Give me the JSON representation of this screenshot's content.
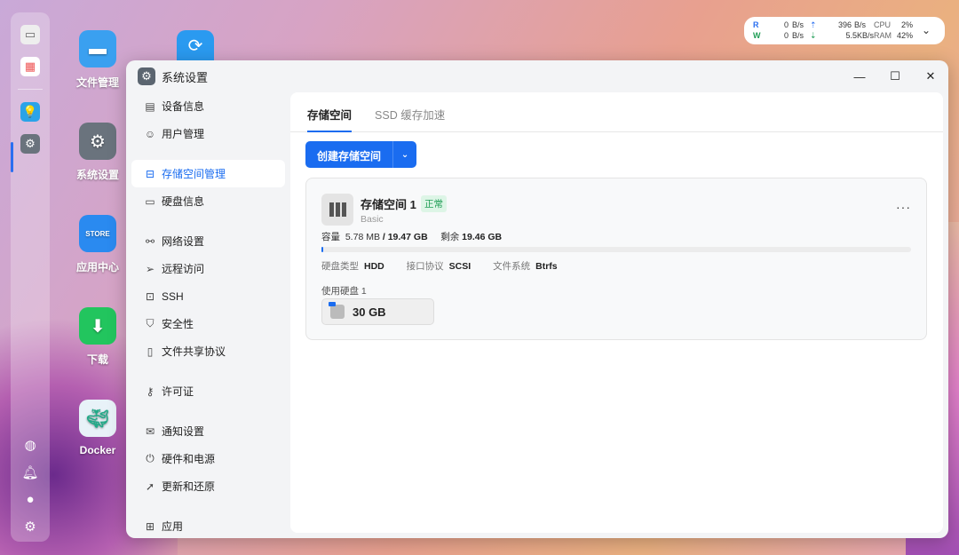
{
  "netmon": {
    "r_label": "R",
    "w_label": "W",
    "r_down": "0",
    "w_down": "0",
    "unit": "B/s",
    "r_up": "396",
    "r_up_unit": "B/s",
    "w_up": "5.5KB/s",
    "cpu_label": "CPU",
    "cpu": "2%",
    "ram_label": "RAM",
    "ram": "42%",
    "colors": {
      "r": "#2a6ff0",
      "w": "#1f9d55"
    }
  },
  "desktop": {
    "icons": [
      {
        "label": "文件管理"
      },
      {
        "label": "系统设置"
      },
      {
        "label": "应用中心"
      },
      {
        "label": "下载"
      },
      {
        "label": "Docker"
      }
    ],
    "store_text": "STORE"
  },
  "window": {
    "title": "系统设置"
  },
  "sidebar": {
    "items": [
      {
        "label": "设备信息",
        "icon": "device-icon"
      },
      {
        "label": "用户管理",
        "icon": "user-icon"
      },
      {
        "label": "存储空间管理",
        "icon": "storage-icon"
      },
      {
        "label": "硬盘信息",
        "icon": "disk-icon"
      },
      {
        "label": "网络设置",
        "icon": "network-icon"
      },
      {
        "label": "远程访问",
        "icon": "send-icon"
      },
      {
        "label": "SSH",
        "icon": "terminal-icon"
      },
      {
        "label": "安全性",
        "icon": "shield-icon"
      },
      {
        "label": "文件共享协议",
        "icon": "file-icon"
      },
      {
        "label": "许可证",
        "icon": "key-icon"
      },
      {
        "label": "通知设置",
        "icon": "mail-icon"
      },
      {
        "label": "硬件和电源",
        "icon": "power-icon"
      },
      {
        "label": "更新和还原",
        "icon": "rocket-icon"
      },
      {
        "label": "应用",
        "icon": "apps-icon"
      }
    ]
  },
  "tabs": [
    {
      "label": "存储空间"
    },
    {
      "label": "SSD 缓存加速"
    }
  ],
  "create_button": "创建存储空间",
  "pool": {
    "name": "存储空间 1",
    "status": "正常",
    "type": "Basic",
    "capacity_label": "容量",
    "used": "5.78 MB",
    "total": "/ 19.47 GB",
    "remaining_label": "剩余",
    "remaining": "19.46 GB",
    "usage_percent": 0.03,
    "disk_type_label": "硬盘类型",
    "disk_type": "HDD",
    "interface_label": "接口协议",
    "interface": "SCSI",
    "fs_label": "文件系统",
    "fs": "Btrfs",
    "used_disks_label": "使用硬盘 1",
    "disk_size": "30 GB"
  },
  "accent": "#1a6cf0"
}
